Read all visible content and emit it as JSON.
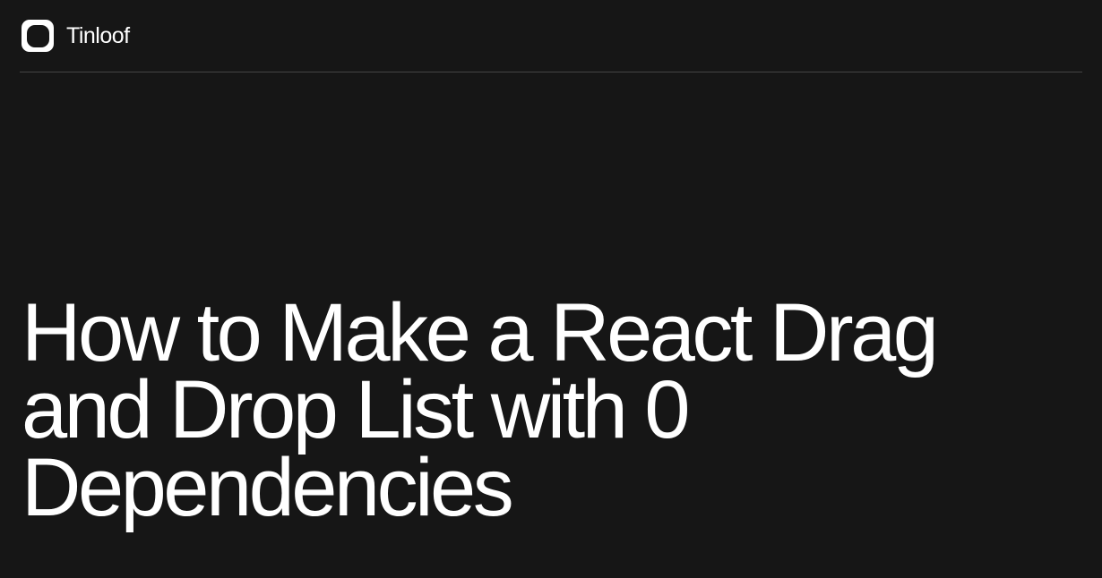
{
  "header": {
    "brand": "Tinloof"
  },
  "article": {
    "title": "How to Make a React Drag and Drop List with 0 Dependencies"
  }
}
